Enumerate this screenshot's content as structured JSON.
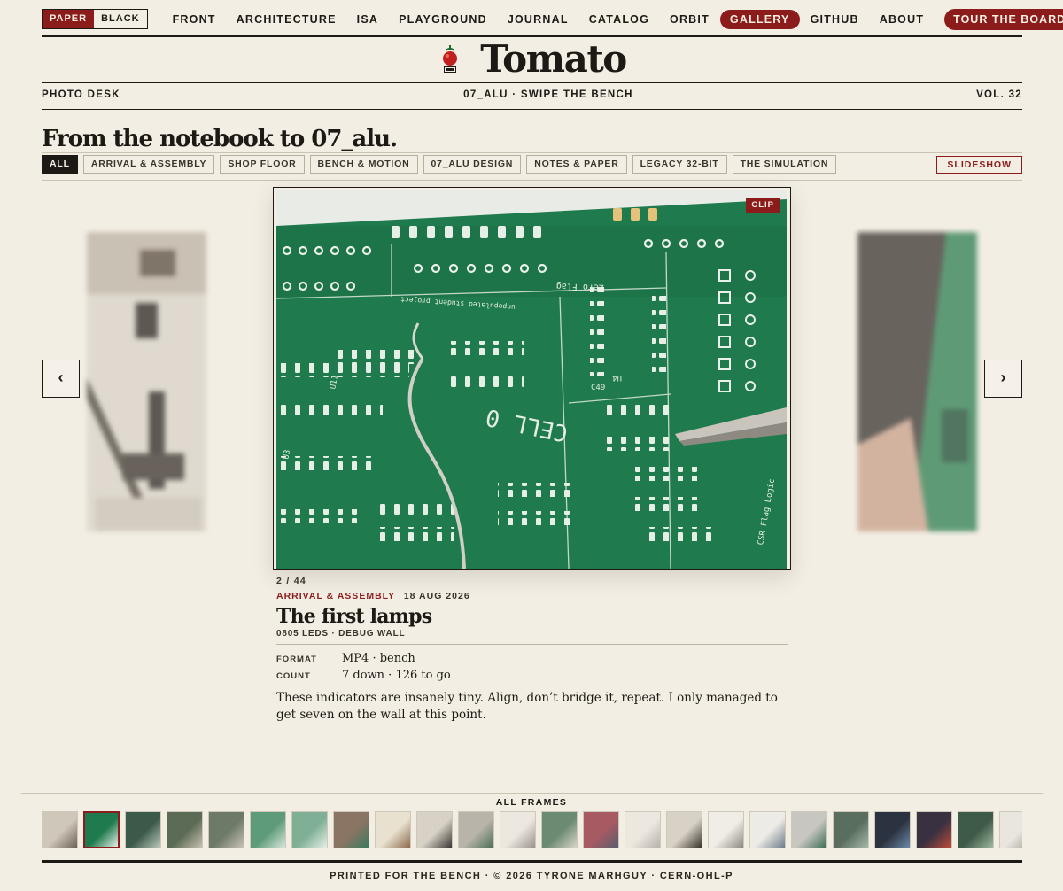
{
  "theme_toggle": {
    "options": [
      "PAPER",
      "BLACK"
    ],
    "active": "PAPER"
  },
  "nav": {
    "items": [
      "FRONT",
      "ARCHITECTURE",
      "ISA",
      "PLAYGROUND",
      "JOURNAL",
      "CATALOG",
      "ORBIT",
      "GALLERY",
      "GITHUB",
      "ABOUT"
    ],
    "active": "GALLERY",
    "cta": "TOUR THE BOARD"
  },
  "masthead": {
    "brand": "Tomato",
    "logo_icon": "tomato-chip-icon"
  },
  "subhead": {
    "left": "PHOTO DESK",
    "center": "07_ALU · SWIPE THE BENCH",
    "right": "VOL. 32"
  },
  "page_title": "From the notebook to 07_alu.",
  "filters": {
    "chips": [
      "ALL",
      "ARRIVAL & ASSEMBLY",
      "SHOP FLOOR",
      "BENCH & MOTION",
      "07_ALU DESIGN",
      "NOTES & PAPER",
      "LEGACY 32-BIT",
      "THE SIMULATION"
    ],
    "active": "ALL",
    "slideshow_label": "SLIDESHOW"
  },
  "carousel": {
    "prev_icon": "chevron-left-icon",
    "next_icon": "chevron-right-icon",
    "prev_label": "‹",
    "next_label": "›",
    "badge": "CLIP"
  },
  "caption": {
    "counter": "2 / 44",
    "section": "ARRIVAL & ASSEMBLY",
    "date": "18 AUG 2026",
    "title": "The first lamps",
    "subtitle": "0805 LEDS · DEBUG WALL",
    "specs": [
      {
        "label": "FORMAT",
        "value": "MP4 · bench"
      },
      {
        "label": "COUNT",
        "value": "7 down · 126 to go"
      }
    ],
    "body": "These indicators are insanely tiny. Align, don’t bridge it, repeat. I only managed to get seven on the wall at this point."
  },
  "pcb_silkscreen": {
    "cell": "CELL 0",
    "flag": "Zero Flag",
    "refs": [
      "U4",
      "C49",
      "U11",
      "U13",
      "U24",
      "U25",
      "U3",
      "U18",
      "U42",
      "U26",
      "C42",
      "U46",
      "U47"
    ],
    "note": "unpopulated student project",
    "logic": "CSR Flag Logic"
  },
  "filmstrip": {
    "label": "ALL FRAMES",
    "thumb_count": 24,
    "active_index": 1
  },
  "footer": "PRINTED FOR THE BENCH · © 2026 TYRONE MARHGUY · CERN-OHL-P",
  "colors": {
    "accent": "#8c1c1c",
    "paper": "#f3eee4",
    "ink": "#1d1a16",
    "pcb_green": "#1f7a4d"
  }
}
